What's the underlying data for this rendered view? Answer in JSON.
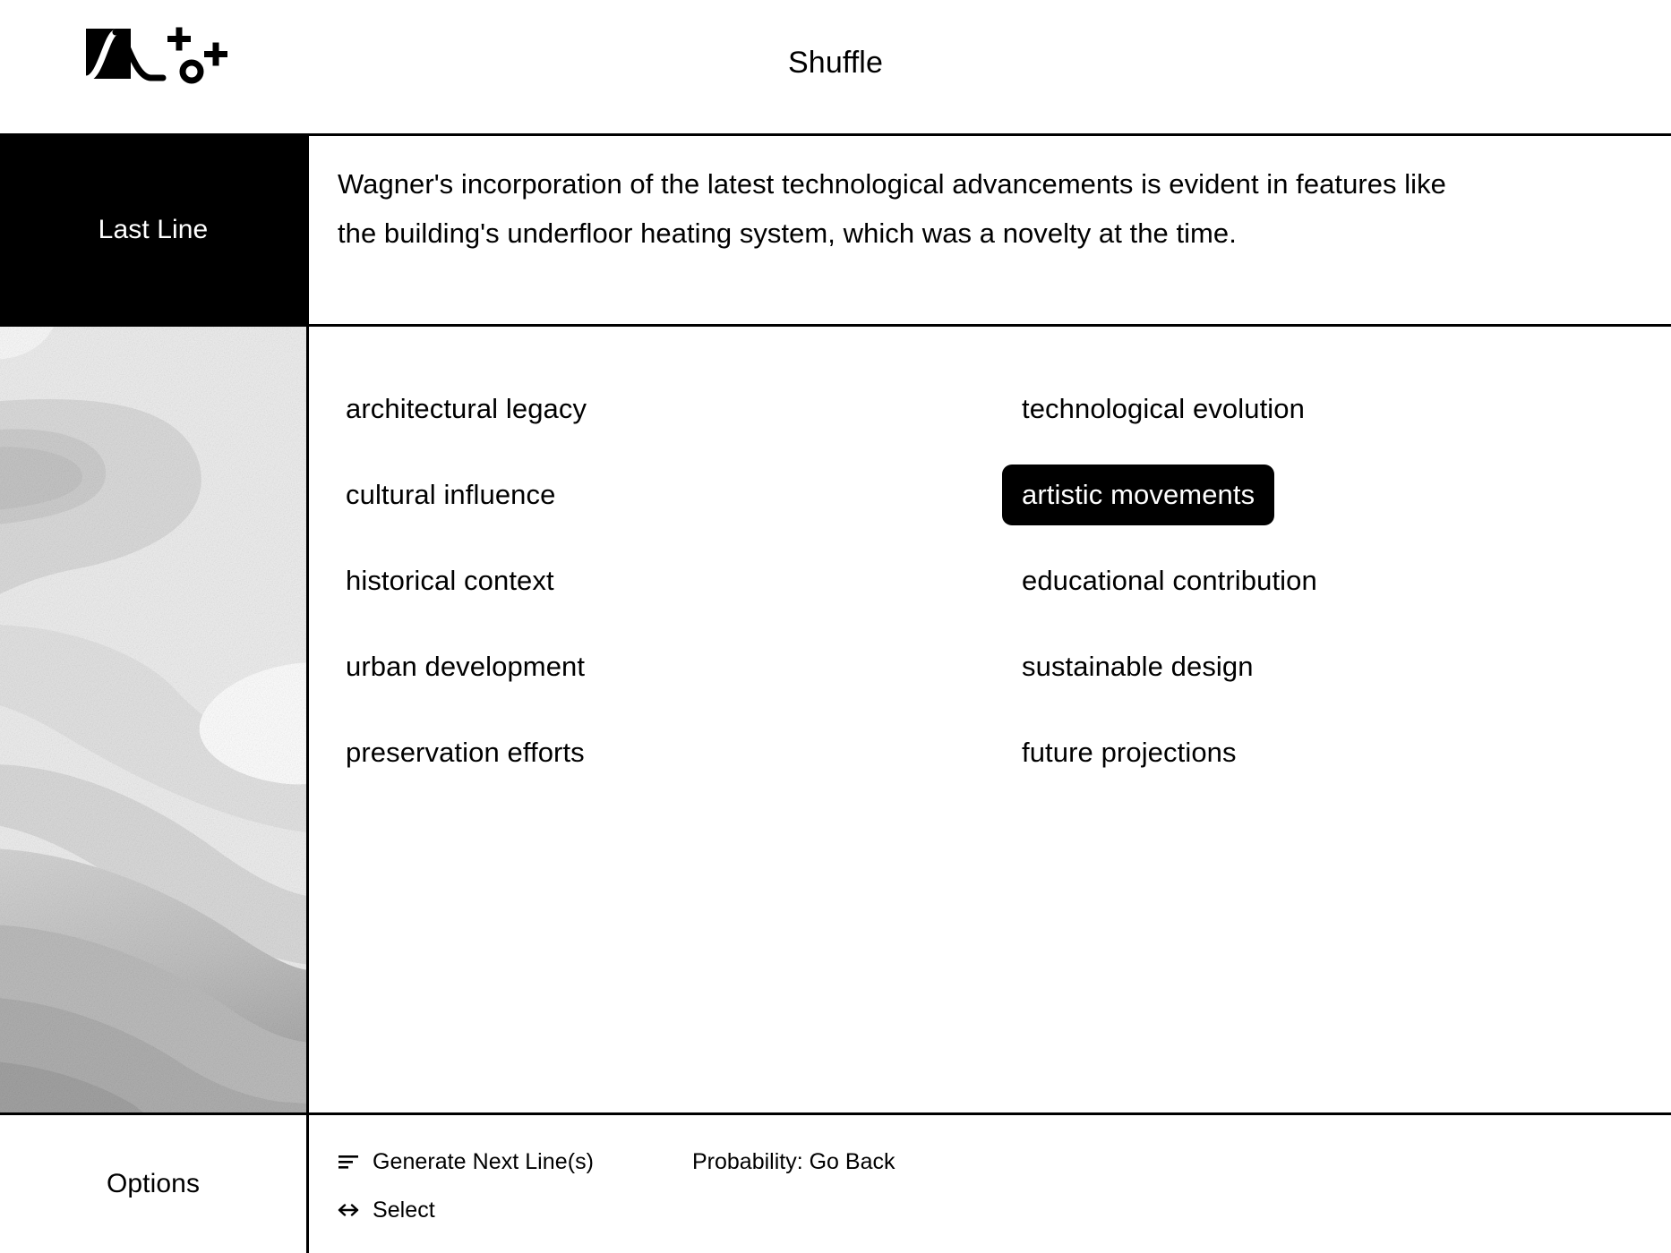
{
  "header": {
    "title": "Shuffle",
    "logo_name": "probability-curve-logo"
  },
  "last_line": {
    "label": "Last Line",
    "text": "Wagner's incorporation of the latest technological advancements is evident in features like the building's underfloor heating system, which was a novelty at the time."
  },
  "options": {
    "left_column": [
      "architectural legacy",
      "cultural influence",
      "historical context",
      "urban development",
      "preservation efforts"
    ],
    "right_column": [
      "technological evolution",
      "artistic movements",
      "educational contribution",
      "sustainable design",
      "future projections"
    ],
    "selected": "artistic movements"
  },
  "bottom": {
    "label": "Options",
    "hints": [
      {
        "icon": "list-lines-icon",
        "label": "Generate Next Line(s)"
      },
      {
        "icon": "left-right-arrow-icon",
        "label": "Select"
      }
    ],
    "probability_hint": "Probability: Go Back"
  },
  "colors": {
    "accent": "#000000",
    "background": "#ffffff",
    "border": "#000000",
    "selected_text": "#ffffff"
  }
}
